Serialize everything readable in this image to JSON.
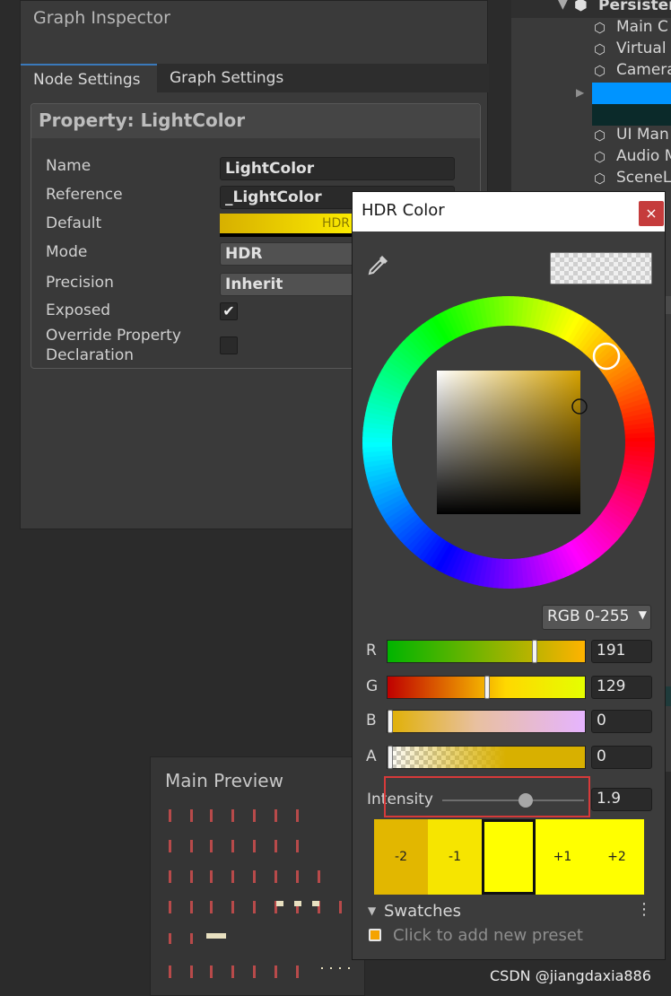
{
  "inspector": {
    "title": "Graph Inspector",
    "tabs": [
      "Node Settings",
      "Graph Settings"
    ],
    "property_title": "Property: LightColor",
    "fields": {
      "name_label": "Name",
      "name_value": "LightColor",
      "reference_label": "Reference",
      "reference_value": "_LightColor",
      "default_label": "Default",
      "default_badge": "HDR",
      "mode_label": "Mode",
      "mode_value": "HDR",
      "precision_label": "Precision",
      "precision_value": "Inherit",
      "exposed_label": "Exposed",
      "exposed_checked": true,
      "override_label_line1": "Override Property",
      "override_label_line2": "Declaration",
      "override_checked": false
    }
  },
  "hierarchy": {
    "root": "Persisten",
    "items": [
      "Main C",
      "Virtual",
      "Camera",
      "UI Man",
      "Audio M",
      "SceneL"
    ]
  },
  "preview": {
    "title": "Main Preview"
  },
  "hdr_color": {
    "title": "HDR Color",
    "close_glyph": "×",
    "mode": "RGB 0-255",
    "channels": [
      {
        "label": "R",
        "value": "191",
        "fraction": 0.75
      },
      {
        "label": "G",
        "value": "129",
        "fraction": 0.506
      },
      {
        "label": "B",
        "value": "0",
        "fraction": 0.0
      },
      {
        "label": "A",
        "value": "0",
        "fraction": 0.0
      }
    ],
    "intensity_label": "Intensity",
    "intensity_value": "1.9",
    "stops": [
      "-2",
      "-1",
      "",
      "+1",
      "+2"
    ],
    "swatches_label": "Swatches",
    "swatches_menu": "⋮",
    "preset_hint": "Click to add new preset"
  },
  "watermark": "CSDN @jiangdaxia886",
  "colors": {
    "accent_tab": "#3a79bb",
    "hierarchy_selected": "#0094ff",
    "highlight_box": "#d63a3a"
  }
}
